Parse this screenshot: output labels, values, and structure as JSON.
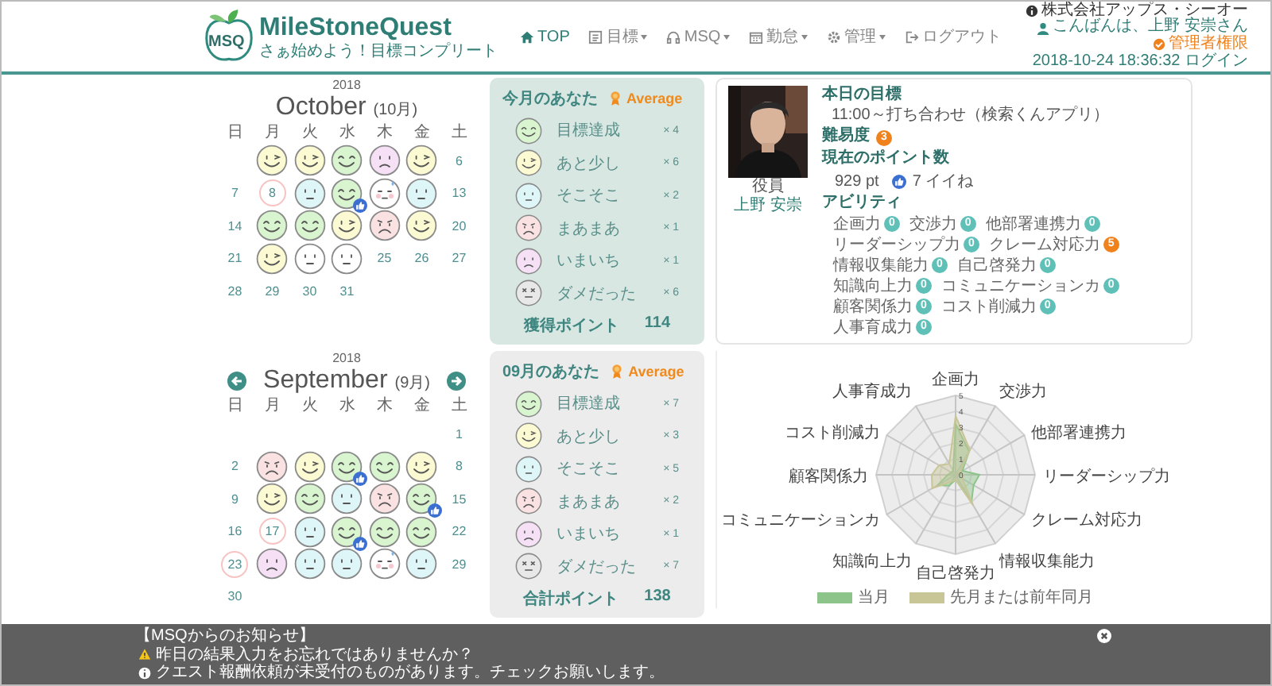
{
  "header": {
    "logo_mark": "MSQ",
    "app_name": "MileStoneQuest",
    "tagline": "さぁ始めよう！目標コンプリート",
    "nav": [
      {
        "label": "TOP",
        "kind": "home",
        "dropdown": false,
        "selected": true
      },
      {
        "label": "目標",
        "kind": "list",
        "dropdown": true,
        "selected": false
      },
      {
        "label": "MSQ",
        "kind": "headphones",
        "dropdown": true,
        "selected": false
      },
      {
        "label": "勤怠",
        "kind": "calendar",
        "dropdown": true,
        "selected": false
      },
      {
        "label": "管理",
        "kind": "gear",
        "dropdown": true,
        "selected": false
      },
      {
        "label": "ログアウト",
        "kind": "logout",
        "dropdown": false,
        "selected": false
      }
    ],
    "company": "株式会社アップス・シーオー",
    "greeting": "こんばんは、上野 安崇さん",
    "role": "管理者権限",
    "login": "2018-10-24 18:36:32 ログイン"
  },
  "months": [
    {
      "calendar": {
        "year": "2018",
        "month": "October",
        "month_ja": "(10月)",
        "nav": false,
        "weekdays": [
          "日",
          "月",
          "火",
          "水",
          "木",
          "金",
          "土"
        ],
        "weeks": [
          [
            {
              "kind": "empty"
            },
            {
              "kind": "good",
              "liked": false
            },
            {
              "kind": "good",
              "liked": false
            },
            {
              "kind": "great",
              "liked": false
            },
            {
              "kind": "poor",
              "liked": false
            },
            {
              "kind": "good",
              "liked": false
            },
            {
              "kind": "day",
              "day": "6",
              "ringed": false
            }
          ],
          [
            {
              "kind": "day",
              "day": "7",
              "ringed": false
            },
            {
              "kind": "day",
              "day": "8",
              "ringed": true
            },
            {
              "kind": "ok",
              "liked": false
            },
            {
              "kind": "great",
              "liked": true
            },
            {
              "kind": "sweat",
              "liked": false
            },
            {
              "kind": "ok",
              "liked": false
            },
            {
              "kind": "day",
              "day": "13",
              "ringed": false
            }
          ],
          [
            {
              "kind": "day",
              "day": "14",
              "ringed": false
            },
            {
              "kind": "great",
              "liked": false
            },
            {
              "kind": "great",
              "liked": false
            },
            {
              "kind": "good",
              "liked": false
            },
            {
              "kind": "meh",
              "liked": false
            },
            {
              "kind": "good",
              "liked": false
            },
            {
              "kind": "day",
              "day": "20",
              "ringed": false
            }
          ],
          [
            {
              "kind": "day",
              "day": "21",
              "ringed": false
            },
            {
              "kind": "good",
              "liked": false
            },
            {
              "kind": "blank",
              "liked": false
            },
            {
              "kind": "blank",
              "liked": false
            },
            {
              "kind": "day",
              "day": "25",
              "ringed": false
            },
            {
              "kind": "day",
              "day": "26",
              "ringed": false
            },
            {
              "kind": "day",
              "day": "27",
              "ringed": false
            }
          ],
          [
            {
              "kind": "day",
              "day": "28",
              "ringed": false
            },
            {
              "kind": "day",
              "day": "29",
              "ringed": false
            },
            {
              "kind": "day",
              "day": "30",
              "ringed": false
            },
            {
              "kind": "day",
              "day": "31",
              "ringed": false
            }
          ]
        ]
      },
      "summary": {
        "current": true,
        "title": "今月のあなた",
        "rating": "Average",
        "rows": [
          {
            "kind": "great",
            "label": "目標達成",
            "count": "× 4"
          },
          {
            "kind": "good",
            "label": "あと少し",
            "count": "× 6"
          },
          {
            "kind": "ok",
            "label": "そこそこ",
            "count": "× 2"
          },
          {
            "kind": "meh",
            "label": "まあまあ",
            "count": "× 1"
          },
          {
            "kind": "poor",
            "label": "いまいち",
            "count": "× 1"
          },
          {
            "kind": "bad",
            "label": "ダメだった",
            "count": "× 6"
          }
        ],
        "total_label": "獲得ポイント",
        "total": "114"
      }
    },
    {
      "calendar": {
        "year": "2018",
        "month": "September",
        "month_ja": "(9月)",
        "nav": true,
        "weekdays": [
          "日",
          "月",
          "火",
          "水",
          "木",
          "金",
          "土"
        ],
        "weeks": [
          [
            {
              "kind": "empty"
            },
            {
              "kind": "empty"
            },
            {
              "kind": "empty"
            },
            {
              "kind": "empty"
            },
            {
              "kind": "empty"
            },
            {
              "kind": "empty"
            },
            {
              "kind": "day",
              "day": "1",
              "ringed": false
            }
          ],
          [
            {
              "kind": "day",
              "day": "2",
              "ringed": false
            },
            {
              "kind": "meh",
              "liked": false
            },
            {
              "kind": "good",
              "liked": false
            },
            {
              "kind": "great",
              "liked": true
            },
            {
              "kind": "great",
              "liked": false
            },
            {
              "kind": "good",
              "liked": false
            },
            {
              "kind": "day",
              "day": "8",
              "ringed": false
            }
          ],
          [
            {
              "kind": "day",
              "day": "9",
              "ringed": false
            },
            {
              "kind": "good",
              "liked": false
            },
            {
              "kind": "great",
              "liked": false
            },
            {
              "kind": "ok",
              "liked": false
            },
            {
              "kind": "meh",
              "liked": false
            },
            {
              "kind": "great",
              "liked": true
            },
            {
              "kind": "day",
              "day": "15",
              "ringed": false
            }
          ],
          [
            {
              "kind": "day",
              "day": "16",
              "ringed": false
            },
            {
              "kind": "day",
              "day": "17",
              "ringed": true
            },
            {
              "kind": "ok",
              "liked": false
            },
            {
              "kind": "great",
              "liked": true
            },
            {
              "kind": "great",
              "liked": false
            },
            {
              "kind": "great",
              "liked": false
            },
            {
              "kind": "day",
              "day": "22",
              "ringed": false
            }
          ],
          [
            {
              "kind": "day",
              "day": "23",
              "ringed": true
            },
            {
              "kind": "poor",
              "liked": false
            },
            {
              "kind": "ok",
              "liked": false
            },
            {
              "kind": "ok",
              "liked": false
            },
            {
              "kind": "sweat",
              "liked": false
            },
            {
              "kind": "ok",
              "liked": false
            },
            {
              "kind": "day",
              "day": "29",
              "ringed": false
            }
          ],
          [
            {
              "kind": "day",
              "day": "30",
              "ringed": false
            }
          ]
        ]
      },
      "summary": {
        "current": false,
        "title": "09月のあなた",
        "rating": "Average",
        "rows": [
          {
            "kind": "great",
            "label": "目標達成",
            "count": "× 7"
          },
          {
            "kind": "good",
            "label": "あと少し",
            "count": "× 3"
          },
          {
            "kind": "ok",
            "label": "そこそこ",
            "count": "× 5"
          },
          {
            "kind": "meh",
            "label": "まあまあ",
            "count": "× 2"
          },
          {
            "kind": "poor",
            "label": "いまいち",
            "count": "× 1"
          },
          {
            "kind": "bad",
            "label": "ダメだった",
            "count": "× 7"
          }
        ],
        "total_label": "合計ポイント",
        "total": "138"
      }
    }
  ],
  "profile": {
    "photo": {
      "kind": "picture"
    },
    "position": "役員",
    "name": "上野 安崇",
    "goal_heading": "本日の目標",
    "goal": "11:00～打ち合わせ（検索くんアプリ）",
    "difficulty_label": "難易度",
    "difficulty": "3",
    "points_heading": "現在のポイント数",
    "points": "929 pt",
    "likes": "7 イイね",
    "ability_heading": "アビリティ",
    "ability_rows": [
      [
        {
          "name": "企画力",
          "value": "0",
          "color": "#5fc0b8"
        },
        {
          "name": "交渉力",
          "value": "0",
          "color": "#5fc0b8"
        },
        {
          "name": "他部署連携力",
          "value": "0",
          "color": "#5fc0b8"
        }
      ],
      [
        {
          "name": "リーダーシップ力",
          "value": "0",
          "color": "#5fc0b8"
        },
        {
          "name": "クレーム対応力",
          "value": "5",
          "color": "#f0821e"
        }
      ],
      [
        {
          "name": "情報収集能力",
          "value": "0",
          "color": "#5fc0b8"
        },
        {
          "name": "自己啓発力",
          "value": "0",
          "color": "#5fc0b8"
        }
      ],
      [
        {
          "name": "知識向上力",
          "value": "0",
          "color": "#5fc0b8"
        },
        {
          "name": "コミュニケーションカ",
          "value": "0",
          "color": "#5fc0b8"
        }
      ],
      [
        {
          "name": "顧客関係力",
          "value": "0",
          "color": "#5fc0b8"
        },
        {
          "name": "コスト削減力",
          "value": "0",
          "color": "#5fc0b8"
        }
      ],
      [
        {
          "name": "人事育成力",
          "value": "0",
          "color": "#5fc0b8"
        }
      ]
    ]
  },
  "radar": {
    "axes": [
      "企画力",
      "人事育成力",
      "交渉力",
      "コスト削減力",
      "他部署連携力",
      "顧客関係力",
      "リーダーシップ力",
      "コミュニケーションカ",
      "クレーム対応力",
      "知識向上力",
      "情報収集能力",
      "自己啓発力"
    ],
    "ticks": [
      "5",
      "4",
      "3",
      "2",
      "1",
      "0"
    ],
    "legend": [
      {
        "label": "当月",
        "color": "#8cc48a"
      },
      {
        "label": "先月または前年同月",
        "color": "#c8c596"
      }
    ]
  },
  "notice": {
    "title": "【MSQからのお知らせ】",
    "items": [
      {
        "kind": "warning",
        "text": "昨日の結果入力をお忘れではありませんか？"
      },
      {
        "kind": "info",
        "text": "クエスト報酬依頼が未受付のものがあります。チェックお願いします。"
      }
    ]
  }
}
